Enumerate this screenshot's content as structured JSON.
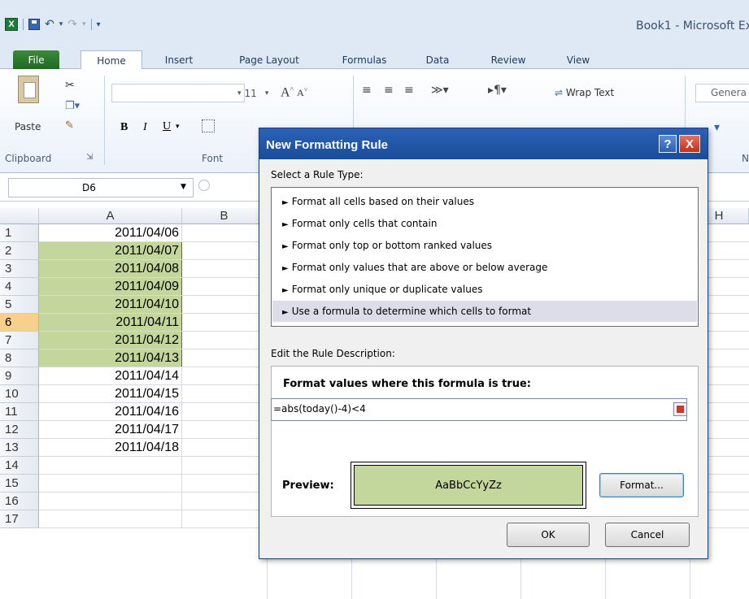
{
  "window": {
    "title": "Book1  -  Microsoft Ex"
  },
  "ribbon": {
    "tabs": [
      "File",
      "Home",
      "Insert",
      "Page Layout",
      "Formulas",
      "Data",
      "Review",
      "View"
    ],
    "groups": {
      "clipboard_label": "Clipboard",
      "font_label": "Font",
      "paste_label": "Paste",
      "font_size": "11",
      "wrap_text": "Wrap Text",
      "number_format": "Genera",
      "number_label": "N"
    }
  },
  "formula_bar": {
    "name_box": "D6"
  },
  "sheet": {
    "columns": [
      "A",
      "B",
      "H"
    ],
    "rows": [
      "1",
      "2",
      "3",
      "4",
      "5",
      "6",
      "7",
      "8",
      "9",
      "10",
      "11",
      "12",
      "13",
      "14",
      "15",
      "16",
      "17"
    ],
    "active_row": "6",
    "column_a_values": [
      "2011/04/06",
      "2011/04/07",
      "2011/04/08",
      "2011/04/09",
      "2011/04/10",
      "2011/04/11",
      "2011/04/12",
      "2011/04/13",
      "2011/04/14",
      "2011/04/15",
      "2011/04/16",
      "2011/04/17",
      "2011/04/18"
    ],
    "highlighted_rows": [
      "2",
      "3",
      "4",
      "5",
      "6",
      "7",
      "8"
    ],
    "highlight_color": "#c3d69b",
    "active_row_color": "#f7d18b"
  },
  "dialog": {
    "title": "New Formatting Rule",
    "help_label": "?",
    "close_label": "X",
    "select_rule_label": "Select a Rule Type:",
    "rule_types": [
      "Format all cells based on their values",
      "Format only cells that contain",
      "Format only top or bottom ranked values",
      "Format only values that are above or below average",
      "Format only unique or duplicate values",
      "Use a formula to determine which cells to format"
    ],
    "selected_rule_index": 5,
    "edit_desc_label": "Edit the Rule Description:",
    "formula_label": "Format values where this formula is true:",
    "formula_value": "=abs(today()-4)<4",
    "preview_label": "Preview:",
    "preview_text": "AaBbCcYyZz",
    "format_button": "Format...",
    "ok_button": "OK",
    "cancel_button": "Cancel",
    "title_color": "#1a4c9a"
  }
}
